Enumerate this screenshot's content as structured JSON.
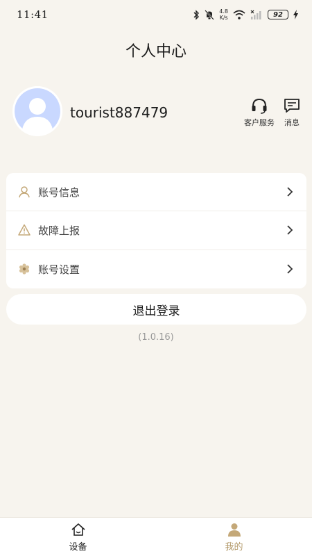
{
  "status_bar": {
    "time": "11:41",
    "speed_value": "4.8",
    "speed_unit": "K/s",
    "battery": "92"
  },
  "header": {
    "title": "个人中心"
  },
  "profile": {
    "username": "tourist887479",
    "actions": [
      {
        "label": "客户服务",
        "icon": "headset-icon"
      },
      {
        "label": "消息",
        "icon": "message-icon"
      }
    ]
  },
  "menu": {
    "items": [
      {
        "label": "账号信息",
        "icon": "user-icon"
      },
      {
        "label": "故障上报",
        "icon": "warning-icon"
      },
      {
        "label": "账号设置",
        "icon": "settings-icon"
      }
    ]
  },
  "logout_label": "退出登录",
  "version": "(1.0.16)",
  "bottom_nav": {
    "tabs": [
      {
        "label": "设备",
        "icon": "home-icon",
        "active": false
      },
      {
        "label": "我的",
        "icon": "profile-icon",
        "active": true
      }
    ]
  },
  "colors": {
    "background": "#f7f4ee",
    "accent": "#b39a6b",
    "avatar_bg": "#c9d8ff"
  }
}
